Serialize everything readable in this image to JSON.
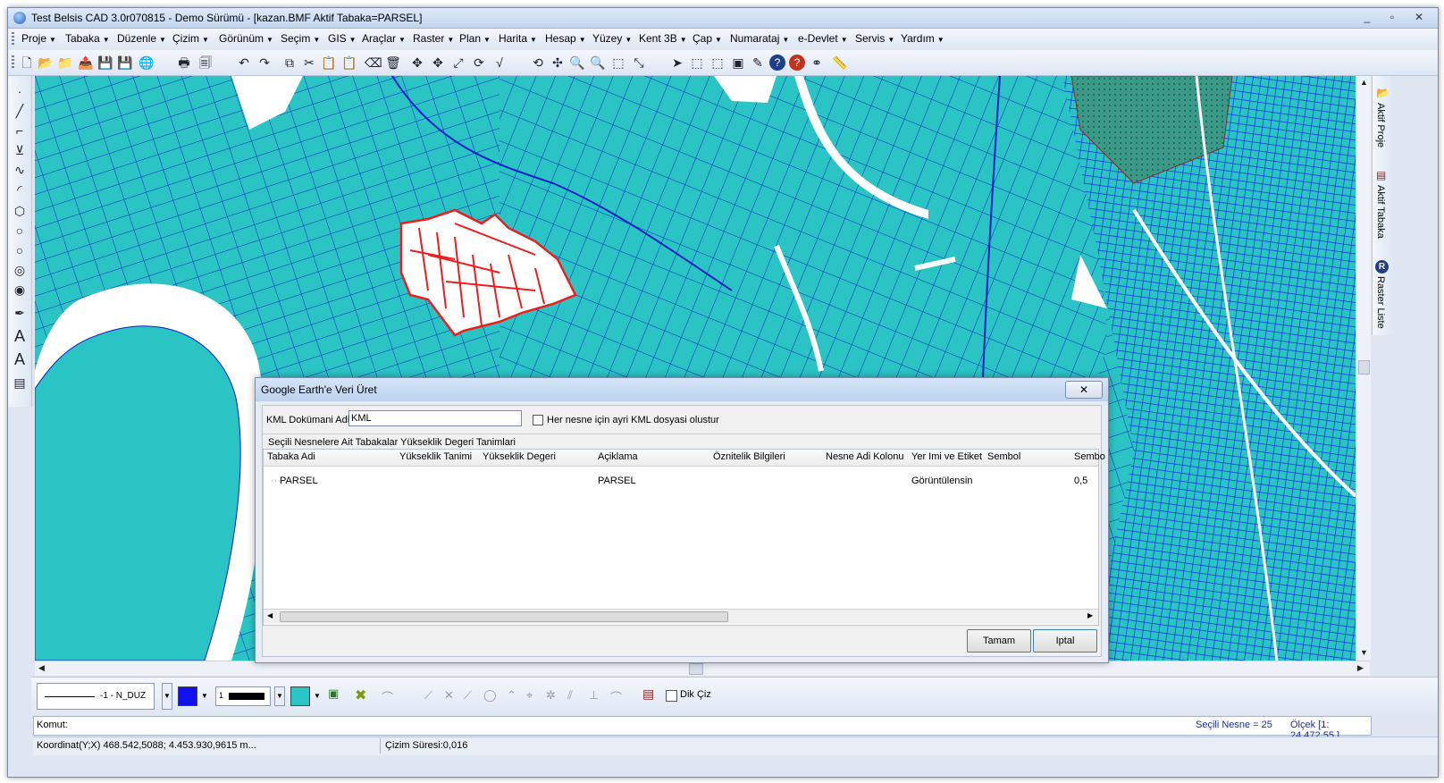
{
  "window": {
    "title": "Test Belsis CAD 3.0r070815 - Demo Sürümü - [kazan.BMF  Aktif Tabaka=PARSEL]",
    "minimize": "_",
    "maximize": "▫",
    "close": "✕"
  },
  "menu": [
    "Proje",
    "Tabaka",
    "Düzenle",
    "Çizim",
    "Görünüm",
    "Seçim",
    "GIS",
    "Araçlar",
    "Raster",
    "Plan",
    "Harita",
    "Hesap",
    "Yüzey",
    "Kent 3B",
    "Çap",
    "Numarataj",
    "e-Devlet",
    "Servis",
    "Yardım"
  ],
  "side_tabs": [
    "Aktif Proje",
    "Aktif Tabaka",
    "Raster Liste"
  ],
  "bottom_toolbar": {
    "linetype": "-1 - N_DUZ",
    "lineweight": "1",
    "dik_ciz": "Dik Çiz"
  },
  "command": {
    "label": "Komut:"
  },
  "status": {
    "selected": "Seçili Nesne = 25",
    "scale": "Ölçek [1: 24.472,55 ]",
    "coords": "Koordinat(Y;X)  468.542,5088; 4.453.930,9615 m...",
    "draw_time": "Çizim Süresi:0,016"
  },
  "dialog": {
    "title": "Google Earth'e Veri Üret",
    "close": "✕",
    "kml_label": "KML Dokümani Adi",
    "kml_value": "KML",
    "separate_checkbox_label": "Her nesne için ayri KML dosyasi olustur",
    "group_label": "Seçili Nesnelere Ait Tabakalar Yükseklik Degeri Tanimlari",
    "columns": [
      "Tabaka Adi",
      "Yükseklik Tanimi",
      "Yükseklik Degeri",
      "Açiklama",
      "Öznitelik Bilgileri",
      "Nesne Adi Kolonu",
      "Yer Imi ve Etiket",
      "Sembol",
      "Sembo"
    ],
    "rows": [
      {
        "tabaka": "PARSEL",
        "aciklama": "PARSEL",
        "yer_imi": "Görüntülensin",
        "sembol_olcek": "0,5"
      }
    ],
    "ok": "Tamam",
    "cancel": "Iptal"
  },
  "colors": {
    "parcel_fill": "#2bc4c4",
    "parcel_line": "#1020c8",
    "selection": "#ee1c1c",
    "dialog_bg": "#e7ecf4"
  }
}
